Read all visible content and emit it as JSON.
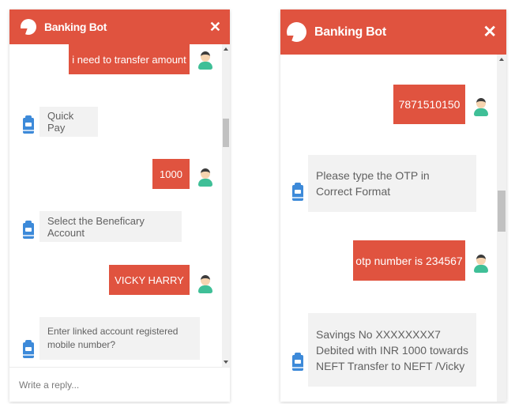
{
  "left_panel": {
    "title": "Banking Bot",
    "close_glyph": "✕",
    "reply_placeholder": "Write a reply...",
    "messages": [
      {
        "from": "user",
        "text": "i need to transfer amount"
      },
      {
        "from": "bot",
        "text": "Quick Pay"
      },
      {
        "from": "user",
        "text": "1000"
      },
      {
        "from": "bot",
        "text": "Select the Beneficary Account"
      },
      {
        "from": "user",
        "text": "VICKY HARRY"
      },
      {
        "from": "bot",
        "text": "Enter linked account registered mobile number?"
      }
    ]
  },
  "right_panel": {
    "title": "Banking Bot",
    "close_glyph": "✕",
    "messages": [
      {
        "from": "user",
        "text": "7871510150"
      },
      {
        "from": "bot",
        "text": "Please type the OTP  in  Correct Format"
      },
      {
        "from": "user",
        "text": "otp number is 234567"
      },
      {
        "from": "bot",
        "text": "Savings No XXXXXXXX7 Debited with INR 1000 towards NEFT Transfer to NEFT /Vicky"
      }
    ]
  },
  "icons": {
    "header_logo": "chat-bubble-icon",
    "close": "close-icon",
    "user_avatar": "user-avatar-icon",
    "bot_avatar": "robot-icon"
  },
  "colors": {
    "accent": "#e0533f",
    "bot_bubble": "#f2f2f2",
    "bot_icon": "#3d8ad9",
    "avatar_shirt": "#3fbf97"
  }
}
